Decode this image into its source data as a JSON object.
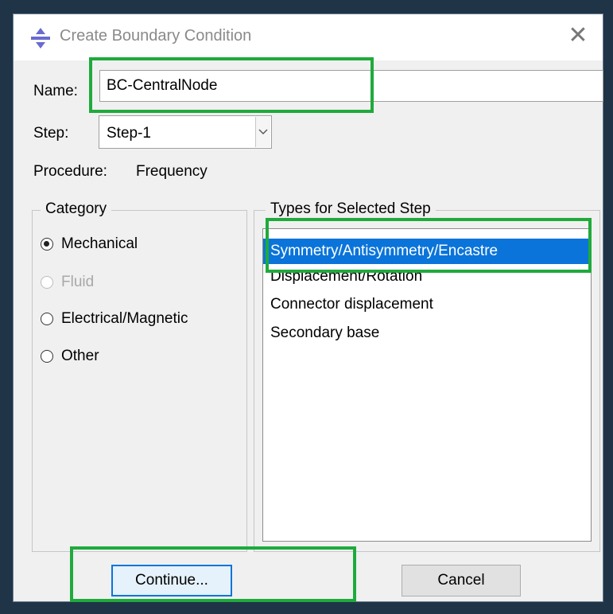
{
  "window": {
    "title": "Create Boundary Condition",
    "close_glyph": "✕"
  },
  "form": {
    "name_label": "Name:",
    "name_value": "BC-CentralNode",
    "step_label": "Step:",
    "step_value": "Step-1",
    "procedure_label": "Procedure:",
    "procedure_value": "Frequency"
  },
  "category": {
    "title": "Category",
    "options": [
      {
        "label": "Mechanical",
        "checked": true,
        "enabled": true
      },
      {
        "label": "Fluid",
        "checked": false,
        "enabled": false
      },
      {
        "label": "Electrical/Magnetic",
        "checked": false,
        "enabled": true
      },
      {
        "label": "Other",
        "checked": false,
        "enabled": true
      }
    ]
  },
  "types": {
    "title": "Types for Selected Step",
    "items": [
      "Symmetry/Antisymmetry/Encastre",
      "Displacement/Rotation",
      "Connector displacement",
      "Secondary base"
    ],
    "selected_index": 0
  },
  "buttons": {
    "continue_label": "Continue...",
    "cancel_label": "Cancel"
  },
  "colors": {
    "accent": "#0a74da",
    "highlight": "#1faa3c"
  }
}
